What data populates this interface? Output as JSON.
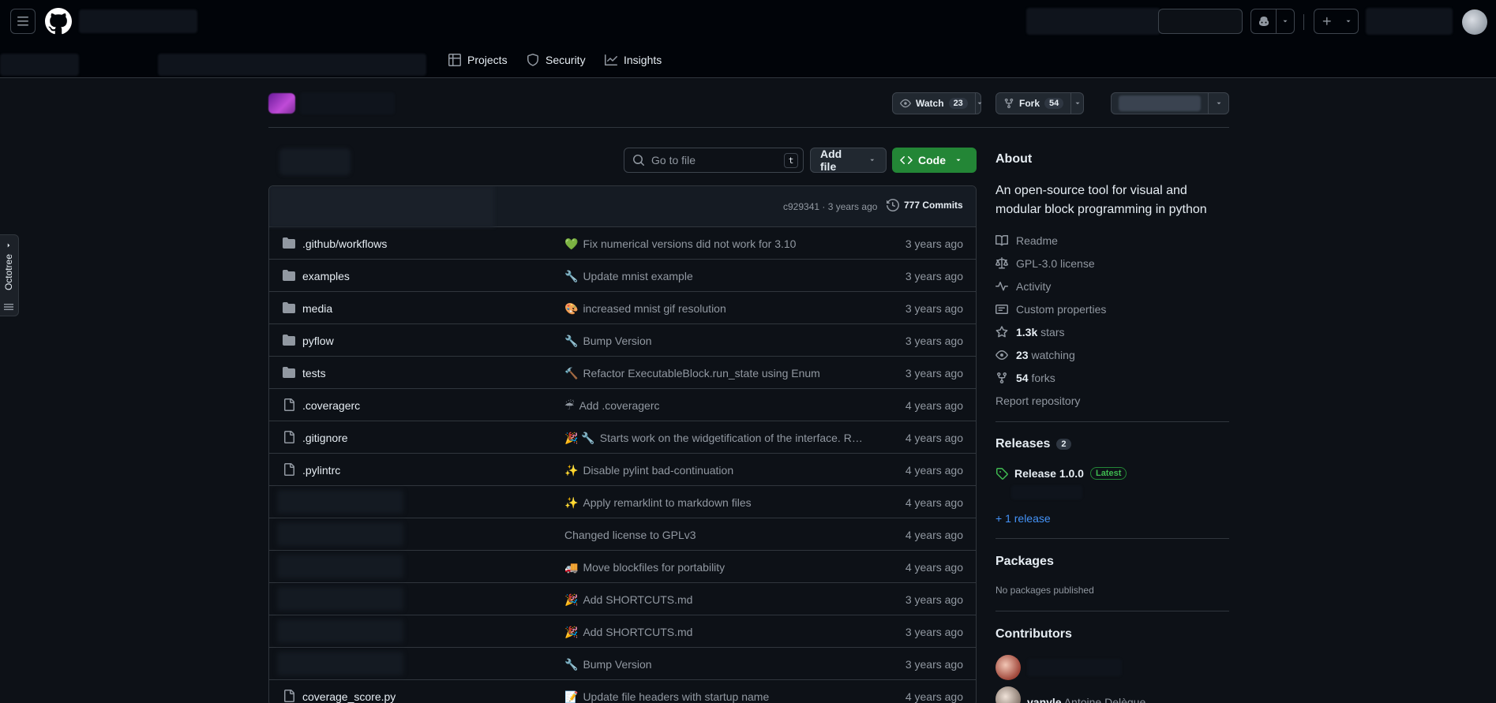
{
  "nav": {
    "projects": "Projects",
    "security": "Security",
    "insights": "Insights"
  },
  "header": {
    "watch_label": "Watch",
    "watch_count": "23",
    "fork_label": "Fork",
    "fork_count": "54"
  },
  "toolbar": {
    "goto_placeholder": "Go to file",
    "goto_shortcut": "t",
    "add_file": "Add file",
    "code": "Code"
  },
  "commit_bar": {
    "sha_time": "c929341 · 3 years ago",
    "commits": "777 Commits"
  },
  "files": [
    {
      "type": "dir",
      "name": ".github/workflows",
      "emoji": "💚",
      "message": "Fix numerical versions did not work for 3.10",
      "age": "3 years ago"
    },
    {
      "type": "dir",
      "name": "examples",
      "emoji": "🔧",
      "message": "Update mnist example",
      "age": "3 years ago"
    },
    {
      "type": "dir",
      "name": "media",
      "emoji": "🎨",
      "message": "increased mnist gif resolution",
      "age": "3 years ago"
    },
    {
      "type": "dir",
      "name": "pyflow",
      "emoji": "🔧",
      "message": "Bump Version",
      "age": "3 years ago"
    },
    {
      "type": "dir",
      "name": "tests",
      "emoji": "🔨",
      "message": "Refactor ExecutableBlock.run_state using Enum",
      "age": "3 years ago"
    },
    {
      "type": "file",
      "name": ".coveragerc",
      "emoji": "☔",
      "message": "Add .coveragerc",
      "age": "4 years ago"
    },
    {
      "type": "file",
      "name": ".gitignore",
      "emoji": "🎉 🔧",
      "message": "Starts work on the widgetification of the interface. Re...",
      "age": "4 years ago"
    },
    {
      "type": "file",
      "name": ".pylintrc",
      "emoji": "✨",
      "message": "Disable pylint bad-continuation",
      "age": "4 years ago"
    },
    {
      "type": "blur",
      "name": "",
      "emoji": "✨",
      "message": "Apply remarklint to markdown files",
      "age": "4 years ago"
    },
    {
      "type": "blur",
      "name": "",
      "emoji": "",
      "message": "Changed license to GPLv3",
      "age": "4 years ago"
    },
    {
      "type": "blur",
      "name": "",
      "emoji": "🚚",
      "message": "Move blockfiles for portability",
      "age": "4 years ago"
    },
    {
      "type": "blur",
      "name": "",
      "emoji": "🎉",
      "message": "Add SHORTCUTS.md",
      "age": "3 years ago"
    },
    {
      "type": "blur",
      "name": "",
      "emoji": "🎉",
      "message": "Add SHORTCUTS.md",
      "age": "3 years ago"
    },
    {
      "type": "blur",
      "name": "",
      "emoji": "🔧",
      "message": "Bump Version",
      "age": "3 years ago"
    },
    {
      "type": "file",
      "name": "coverage_score.py",
      "emoji": "📝",
      "message": "Update file headers with startup name",
      "age": "4 years ago"
    }
  ],
  "about": {
    "title": "About",
    "description": "An open-source tool for visual and modular block programming in python",
    "readme": "Readme",
    "license": "GPL-3.0 license",
    "activity": "Activity",
    "custom_properties": "Custom properties",
    "stars_count": "1.3k",
    "stars_label": "stars",
    "watching_count": "23",
    "watching_label": "watching",
    "forks_count": "54",
    "forks_label": "forks",
    "report": "Report repository"
  },
  "releases": {
    "title": "Releases",
    "count": "2",
    "latest_name": "Release 1.0.0",
    "latest_badge": "Latest",
    "more": "+ 1 release"
  },
  "packages": {
    "title": "Packages",
    "empty": "No packages published"
  },
  "contributors": {
    "title": "Contributors",
    "second_user": "vanyle",
    "second_name": "Antoine Delègue"
  },
  "octotree": {
    "label": "Octotree"
  },
  "colors": {
    "background": "#0d1117",
    "header": "#010409",
    "border": "#30363d",
    "accent_green": "#238636",
    "link_blue": "#4493f8"
  }
}
